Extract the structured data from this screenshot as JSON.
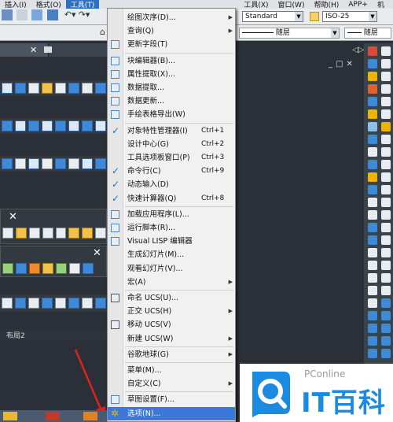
{
  "menubar": {
    "items": [
      "插入(I)",
      "格式(O)",
      "工具(T)",
      "",
      "",
      "",
      "",
      "",
      "",
      "",
      "",
      "",
      "",
      "",
      "工具(X)",
      "窗口(W)",
      "帮助(H)",
      "APP+",
      "机"
    ]
  },
  "toolbar": {
    "style_value": "Standard",
    "dim_value": "ISO-25",
    "layer_label": "随层",
    "linetype_label": "随层"
  },
  "tabs": {
    "layout_tab": "布局2"
  },
  "menu": {
    "items": [
      {
        "label": "绘图次序(D)...",
        "shortcut": "",
        "submenu": true,
        "checked": false,
        "icon": ""
      },
      {
        "label": "查询(Q)",
        "shortcut": "",
        "submenu": true,
        "checked": false,
        "icon": ""
      },
      {
        "label": "更新字段(T)",
        "shortcut": "",
        "submenu": false,
        "checked": false,
        "icon": "field-icon"
      },
      {
        "label": "块编辑器(B)...",
        "shortcut": "",
        "submenu": false,
        "checked": false,
        "icon": "block-editor-icon"
      },
      {
        "label": "属性提取(X)...",
        "shortcut": "",
        "submenu": false,
        "checked": false,
        "icon": "attribute-icon"
      },
      {
        "label": "数据提取...",
        "shortcut": "",
        "submenu": false,
        "checked": false,
        "icon": "data-extract-icon"
      },
      {
        "label": "数据更新...",
        "shortcut": "",
        "submenu": false,
        "checked": false,
        "icon": "data-update-icon"
      },
      {
        "label": "手绘表格导出(W)",
        "shortcut": "",
        "submenu": false,
        "checked": false,
        "icon": "table-export-icon"
      },
      {
        "label": "对象特性管理器(I)",
        "shortcut": "Ctrl+1",
        "submenu": false,
        "checked": true,
        "icon": ""
      },
      {
        "label": "设计中心(G)",
        "shortcut": "Ctrl+2",
        "submenu": false,
        "checked": false,
        "icon": ""
      },
      {
        "label": "工具选项板窗口(P)",
        "shortcut": "Ctrl+3",
        "submenu": false,
        "checked": false,
        "icon": ""
      },
      {
        "label": "命令行(C)",
        "shortcut": "Ctrl+9",
        "submenu": false,
        "checked": true,
        "icon": ""
      },
      {
        "label": "动态输入(D)",
        "shortcut": "",
        "submenu": false,
        "checked": true,
        "icon": ""
      },
      {
        "label": "快速计算器(Q)",
        "shortcut": "Ctrl+8",
        "submenu": false,
        "checked": true,
        "icon": ""
      },
      {
        "label": "加载应用程序(L)...",
        "shortcut": "",
        "submenu": false,
        "checked": false,
        "icon": "load-app-icon"
      },
      {
        "label": "运行脚本(R)...",
        "shortcut": "",
        "submenu": false,
        "checked": false,
        "icon": "script-icon"
      },
      {
        "label": "Visual LISP 编辑器",
        "shortcut": "",
        "submenu": false,
        "checked": false,
        "icon": "lisp-icon"
      },
      {
        "label": "生成幻灯片(M)...",
        "shortcut": "",
        "submenu": false,
        "checked": false,
        "icon": ""
      },
      {
        "label": "观看幻灯片(V)...",
        "shortcut": "",
        "submenu": false,
        "checked": false,
        "icon": ""
      },
      {
        "label": "宏(A)",
        "shortcut": "",
        "submenu": true,
        "checked": false,
        "icon": ""
      },
      {
        "label": "命名 UCS(U)...",
        "shortcut": "",
        "submenu": false,
        "checked": false,
        "icon": "ucs-named-icon"
      },
      {
        "label": "正交 UCS(H)",
        "shortcut": "",
        "submenu": true,
        "checked": false,
        "icon": ""
      },
      {
        "label": "移动 UCS(V)",
        "shortcut": "",
        "submenu": false,
        "checked": false,
        "icon": "ucs-move-icon"
      },
      {
        "label": "新建 UCS(W)",
        "shortcut": "",
        "submenu": true,
        "checked": false,
        "icon": ""
      },
      {
        "label": "谷歌地球(G)",
        "shortcut": "",
        "submenu": true,
        "checked": false,
        "icon": ""
      },
      {
        "label": "菜单(M)...",
        "shortcut": "",
        "submenu": false,
        "checked": false,
        "icon": ""
      },
      {
        "label": "自定义(C)",
        "shortcut": "",
        "submenu": true,
        "checked": false,
        "icon": ""
      },
      {
        "label": "草图设置(F)...",
        "shortcut": "",
        "submenu": false,
        "checked": false,
        "icon": "grid-icon"
      },
      {
        "label": "选项(N)...",
        "shortcut": "",
        "submenu": false,
        "checked": false,
        "icon": "gear-icon",
        "highlighted": true
      }
    ]
  },
  "logo": {
    "brand": "PConline",
    "text": "IT百科"
  },
  "colors": {
    "menu_highlight": "#3b78d8",
    "check": "#1f6fd0",
    "logo_blue": "#1a8be0"
  }
}
